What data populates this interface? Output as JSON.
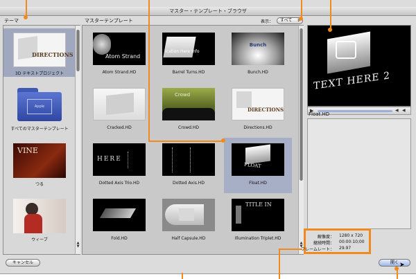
{
  "window": {
    "title": "マスター・テンプレート・ブラウザ"
  },
  "labels": {
    "theme": "テーマ",
    "master_templates": "マスターテンプレート",
    "display": "表示："
  },
  "filter": {
    "selected": "すべて",
    "arrow": "⇕"
  },
  "themes": [
    {
      "label": "3D テキストプロジェクト",
      "selected": true
    },
    {
      "label": "すべてのマスターテンプレート",
      "selected": false
    },
    {
      "label": "つる",
      "selected": false
    },
    {
      "label": "ウィーブ",
      "selected": false
    }
  ],
  "theme_thumbs": {
    "directions": "DIRECTIONS",
    "vine": "VINE",
    "folder_badge": "Apple"
  },
  "templates": [
    {
      "label": "Atom Strand.HD",
      "thumb_text": "Atom Strand",
      "selected": false
    },
    {
      "label": "Barrel Turns.HD",
      "thumb_text": "ication Here Info",
      "selected": false
    },
    {
      "label": "Bunch.HD",
      "thumb_text": "Bunch",
      "selected": false
    },
    {
      "label": "Cracked.HD",
      "thumb_text": "",
      "selected": false
    },
    {
      "label": "Crowd.HD",
      "thumb_text": "Crowd",
      "selected": false
    },
    {
      "label": "Directions.HD",
      "thumb_text": "DIRECTIONS",
      "selected": false
    },
    {
      "label": "Dotted Axis Trio.HD",
      "thumb_text": "HERE",
      "selected": false
    },
    {
      "label": "Dotted Axis.HD",
      "thumb_text": "",
      "selected": false
    },
    {
      "label": "Float.HD",
      "thumb_text": "FLOAT",
      "selected": true
    },
    {
      "label": "Fold.HD",
      "thumb_text": "",
      "selected": false
    },
    {
      "label": "Half Capsule.HD",
      "thumb_text": "",
      "selected": false
    },
    {
      "label": "Illumination Triplet.HD",
      "thumb_text": "TITLE IN",
      "selected": false
    }
  ],
  "preview": {
    "name": "Float.HD",
    "text": "TEXT HERE 2"
  },
  "info": {
    "resolution_label": "解像度：",
    "resolution": "1280 x 720",
    "duration_label": "継続時間：",
    "duration": "00:00:10;00",
    "framerate_label": "フレームレート：",
    "framerate": "29.97"
  },
  "buttons": {
    "cancel": "キャンセル",
    "open": "開く"
  },
  "colors": {
    "accent": "#f08a1e",
    "selection": "#a7afc6"
  }
}
